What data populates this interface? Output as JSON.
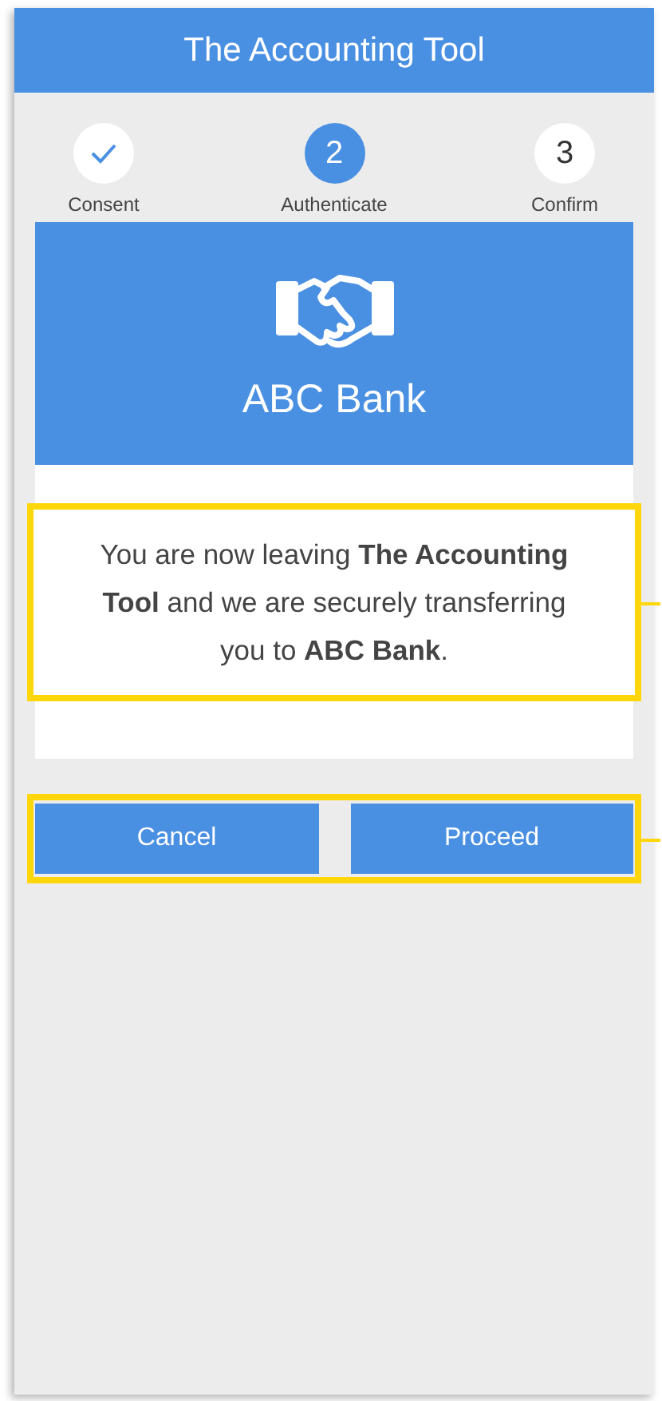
{
  "header": {
    "title": "The Accounting Tool"
  },
  "steps": [
    {
      "label": "Consent",
      "kind": "done"
    },
    {
      "number": "2",
      "label": "Authenticate",
      "kind": "active"
    },
    {
      "number": "3",
      "label": "Confirm",
      "kind": "pending"
    }
  ],
  "bank": {
    "name": "ABC Bank"
  },
  "message": {
    "text": "You are now leaving **The Accounting Tool** and we are securely transferring you to **ABC Bank**.",
    "highlighted": true
  },
  "actions": {
    "highlighted": true,
    "buttons": [
      {
        "label": "Cancel"
      },
      {
        "label": "Proceed"
      }
    ]
  }
}
